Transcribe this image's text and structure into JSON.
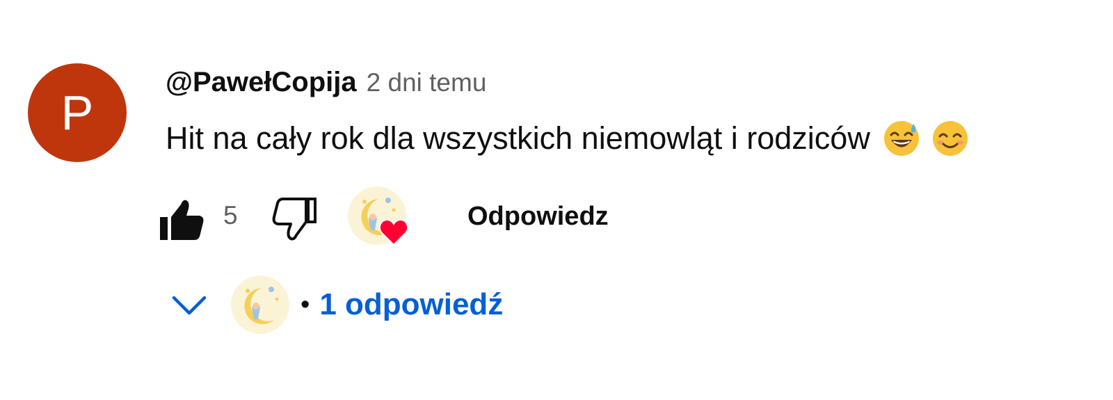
{
  "comment": {
    "avatar_letter": "P",
    "author": "@PawełCopija",
    "time": "2 dni temu",
    "text": "Hit na cały rok dla wszystkich niemowląt i rodziców",
    "emojis": [
      "grinning-sweat-emoji",
      "smiling-blush-emoji"
    ],
    "avatar_color": "#bf360c"
  },
  "actions": {
    "like_count": "5",
    "reply_label": "Odpowiedz",
    "liked": true,
    "creator_hearted": true,
    "heart_color": "#ff0033"
  },
  "replies": {
    "bullet": "•",
    "label": "1 odpowiedź",
    "link_color": "#065fd4"
  }
}
